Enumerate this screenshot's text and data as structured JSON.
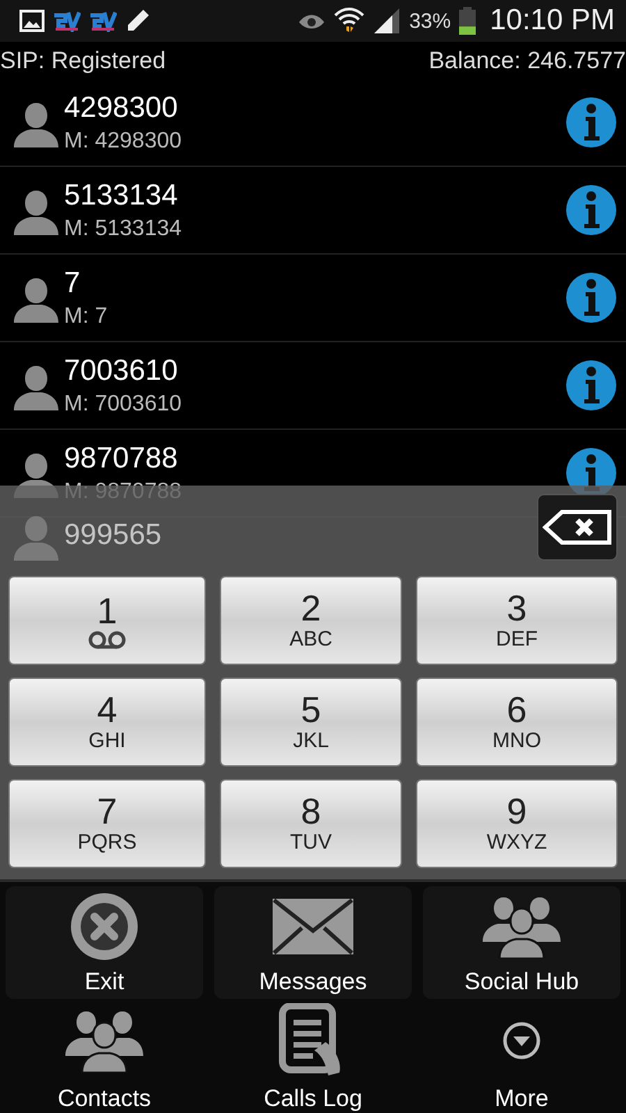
{
  "status_bar": {
    "battery_percent": "33%",
    "level": 0.33,
    "time": "10:10 PM"
  },
  "header": {
    "sip_status": "SIP: Registered",
    "balance": "Balance: 246.7577"
  },
  "contacts": [
    {
      "name": "4298300",
      "number": "M: 4298300"
    },
    {
      "name": "5133134",
      "number": "M: 5133134"
    },
    {
      "name": "7",
      "number": "M: 7"
    },
    {
      "name": "7003610",
      "number": "M: 7003610"
    },
    {
      "name": "9870788",
      "number": "M: 9870788"
    },
    {
      "name": "999565"
    }
  ],
  "keypad": {
    "keys": [
      {
        "digit": "1",
        "kind": "voicemail"
      },
      {
        "digit": "2",
        "letters": "ABC"
      },
      {
        "digit": "3",
        "letters": "DEF"
      },
      {
        "digit": "4",
        "letters": "GHI"
      },
      {
        "digit": "5",
        "letters": "JKL"
      },
      {
        "digit": "6",
        "letters": "MNO"
      },
      {
        "digit": "7",
        "letters": "PQRS"
      },
      {
        "digit": "8",
        "letters": "TUV"
      },
      {
        "digit": "9",
        "letters": "WXYZ"
      }
    ]
  },
  "menu": [
    {
      "label": "Exit",
      "kind": "exit"
    },
    {
      "label": "Messages",
      "kind": "messages"
    },
    {
      "label": "Social Hub",
      "kind": "social"
    },
    {
      "label": "Contacts",
      "kind": "contacts"
    },
    {
      "label": "Calls Log",
      "kind": "calls"
    },
    {
      "label": "More",
      "kind": "more"
    }
  ]
}
